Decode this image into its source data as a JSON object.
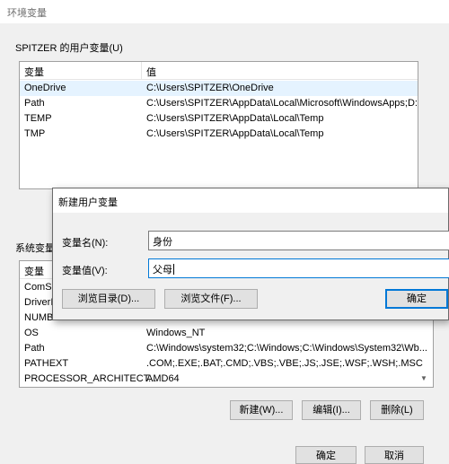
{
  "window": {
    "title": "环境变量"
  },
  "user_vars": {
    "group_label": "SPITZER 的用户变量(U)",
    "col_name": "变量",
    "col_value": "值",
    "rows": [
      {
        "name": "OneDrive",
        "value": "C:\\Users\\SPITZER\\OneDrive"
      },
      {
        "name": "Path",
        "value": "C:\\Users\\SPITZER\\AppData\\Local\\Microsoft\\WindowsApps;D:..."
      },
      {
        "name": "TEMP",
        "value": "C:\\Users\\SPITZER\\AppData\\Local\\Temp"
      },
      {
        "name": "TMP",
        "value": "C:\\Users\\SPITZER\\AppData\\Local\\Temp"
      }
    ]
  },
  "system_vars": {
    "group_label": "系统变量",
    "col_name": "变量",
    "rows": [
      {
        "name": "ComSp",
        "value": ""
      },
      {
        "name": "DriverI",
        "value": ""
      },
      {
        "name": "NUMB",
        "value": ""
      },
      {
        "name": "OS",
        "value": "Windows_NT"
      },
      {
        "name": "Path",
        "value": "C:\\Windows\\system32;C:\\Windows;C:\\Windows\\System32\\Wb..."
      },
      {
        "name": "PATHEXT",
        "value": ".COM;.EXE;.BAT;.CMD;.VBS;.VBE;.JS;.JSE;.WSF;.WSH;.MSC"
      },
      {
        "name": "PROCESSOR_ARCHITECT...",
        "value": "AMD64"
      }
    ],
    "buttons": {
      "new": "新建(W)...",
      "edit": "编辑(I)...",
      "delete": "删除(L)"
    }
  },
  "footer": {
    "ok": "确定",
    "cancel": "取消"
  },
  "dialog": {
    "title": "新建用户变量",
    "name_label": "变量名(N):",
    "name_value": "身份",
    "value_label": "变量值(V):",
    "value_value": "父母",
    "browse_dir": "浏览目录(D)...",
    "browse_file": "浏览文件(F)...",
    "ok": "确定"
  },
  "colors": {
    "accent": "#0078d7",
    "selection": "#e5f3ff"
  }
}
